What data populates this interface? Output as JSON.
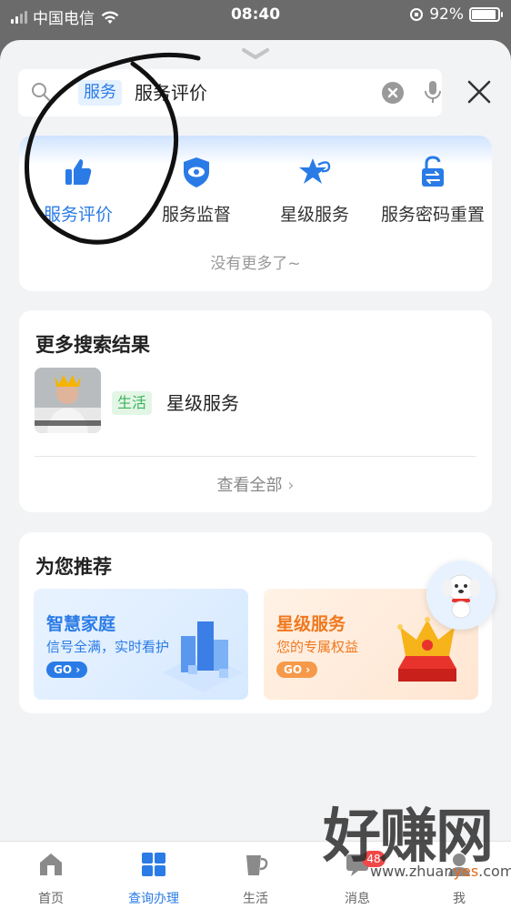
{
  "status_bar": {
    "carrier": "中国电信",
    "time": "08:40",
    "battery_percent": "92%",
    "battery_level": 0.92
  },
  "search": {
    "tag": "服务",
    "query": "服务评价"
  },
  "services": {
    "items": [
      {
        "label": "服务评价",
        "icon": "thumbs-up-icon"
      },
      {
        "label": "服务监督",
        "icon": "eye-shield-icon"
      },
      {
        "label": "星级服务",
        "icon": "star-icon"
      },
      {
        "label": "服务密码重置",
        "icon": "unlock-icon"
      }
    ],
    "no_more": "没有更多了~"
  },
  "more_results": {
    "title": "更多搜索结果",
    "item": {
      "tag": "生活",
      "title": "星级服务"
    },
    "view_all": "查看全部"
  },
  "recommend": {
    "title": "为您推荐",
    "cards": [
      {
        "title": "智慧家庭",
        "subtitle": "信号全满，实时看护",
        "go": "GO",
        "color": "#2a7be6"
      },
      {
        "title": "星级服务",
        "subtitle": "您的专属权益",
        "go": "GO",
        "color": "#f0781e"
      }
    ]
  },
  "tabbar": {
    "tabs": [
      {
        "label": "首页"
      },
      {
        "label": "查询办理"
      },
      {
        "label": "生活"
      },
      {
        "label": "消息"
      },
      {
        "label": "我"
      }
    ],
    "badge": "48"
  },
  "watermark": {
    "big": "好赚网",
    "small_pre": "www.zhuan",
    "small_hl": "yes",
    "small_post": ".com"
  },
  "colors": {
    "accent": "#2a7be6",
    "orange": "#f0781e",
    "green_tag": "#3cb35a"
  }
}
